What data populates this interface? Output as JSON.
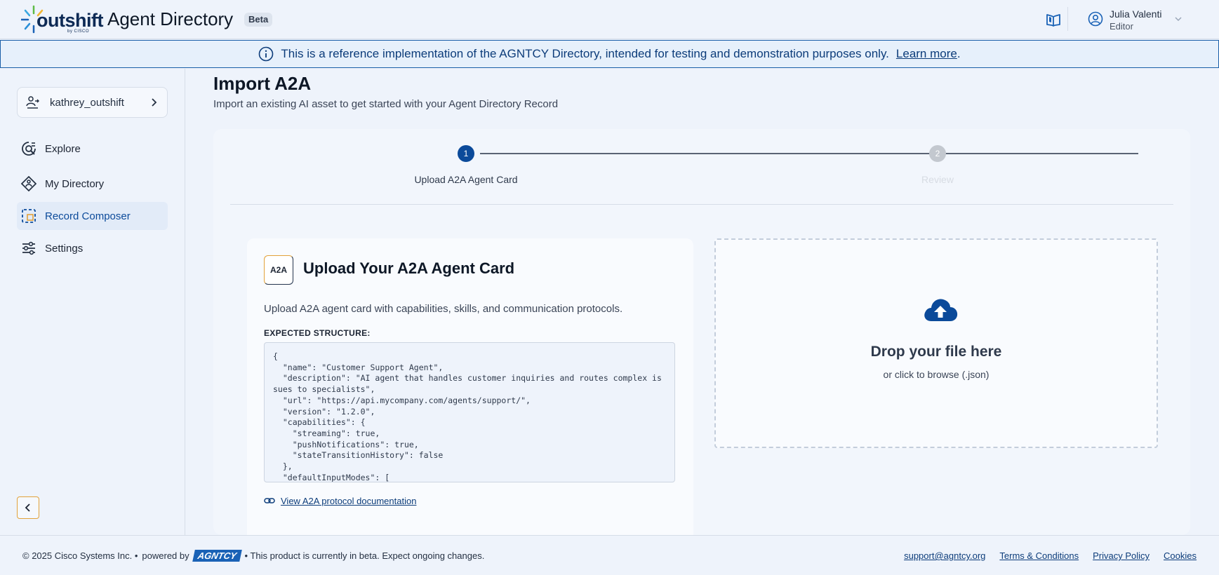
{
  "header": {
    "logo_word": "outshift",
    "logo_sub": "by CISCO",
    "app_title": "Agent Directory",
    "badge": "Beta",
    "user": {
      "name": "Julia Valenti",
      "role": "Editor"
    }
  },
  "banner": {
    "text": "This is a reference implementation of the AGNTCY Directory, intended for testing and demonstration purposes only.",
    "link": "Learn more",
    "suffix": "."
  },
  "sidebar": {
    "org": "kathrey_outshift",
    "items": [
      {
        "label": "Explore",
        "icon": "explore-icon"
      },
      {
        "label": "My Directory",
        "icon": "directory-icon"
      },
      {
        "label": "Record Composer",
        "icon": "composer-icon",
        "active": true
      },
      {
        "label": "Settings",
        "icon": "settings-icon"
      }
    ]
  },
  "main": {
    "title": "Import A2A",
    "subtitle": "Import an existing AI asset to get started with your Agent Directory Record",
    "steps": [
      {
        "number": "1",
        "label": "Upload A2A Agent Card",
        "state": "active"
      },
      {
        "number": "2",
        "label": "Review",
        "state": "inactive"
      }
    ],
    "panel": {
      "logo": "A2A",
      "title": "Upload Your A2A Agent Card",
      "description": "Upload A2A agent card with capabilities, skills, and communication protocols.",
      "structure_label": "EXPECTED STRUCTURE:",
      "code": "{\n  \"name\": \"Customer Support Agent\",\n  \"description\": \"AI agent that handles customer inquiries and routes complex issues to specialists\",\n  \"url\": \"https://api.mycompany.com/agents/support/\",\n  \"version\": \"1.2.0\",\n  \"capabilities\": {\n    \"streaming\": true,\n    \"pushNotifications\": true,\n    \"stateTransitionHistory\": false\n  },\n  \"defaultInputModes\": [\n    \"text\",\n    \"file\"\n  ]\n}",
      "doc_link": "View A2A protocol documentation"
    },
    "dropzone": {
      "title": "Drop your file here",
      "subtitle": "or click to browse (.json)"
    }
  },
  "footer": {
    "copyright": "© 2025 Cisco Systems Inc. •",
    "powered": "powered by",
    "agntcy": "AGNTCY",
    "beta_note": "• This product is currently in beta. Expect ongoing changes.",
    "links": [
      "support@agntcy.org",
      "Terms & Conditions",
      "Privacy Policy",
      "Cookies"
    ]
  },
  "colors": {
    "accent": "#0b4a9a",
    "background": "#eef3fb",
    "banner_border": "#1a5fa8",
    "highlight": "#e2a23a"
  }
}
